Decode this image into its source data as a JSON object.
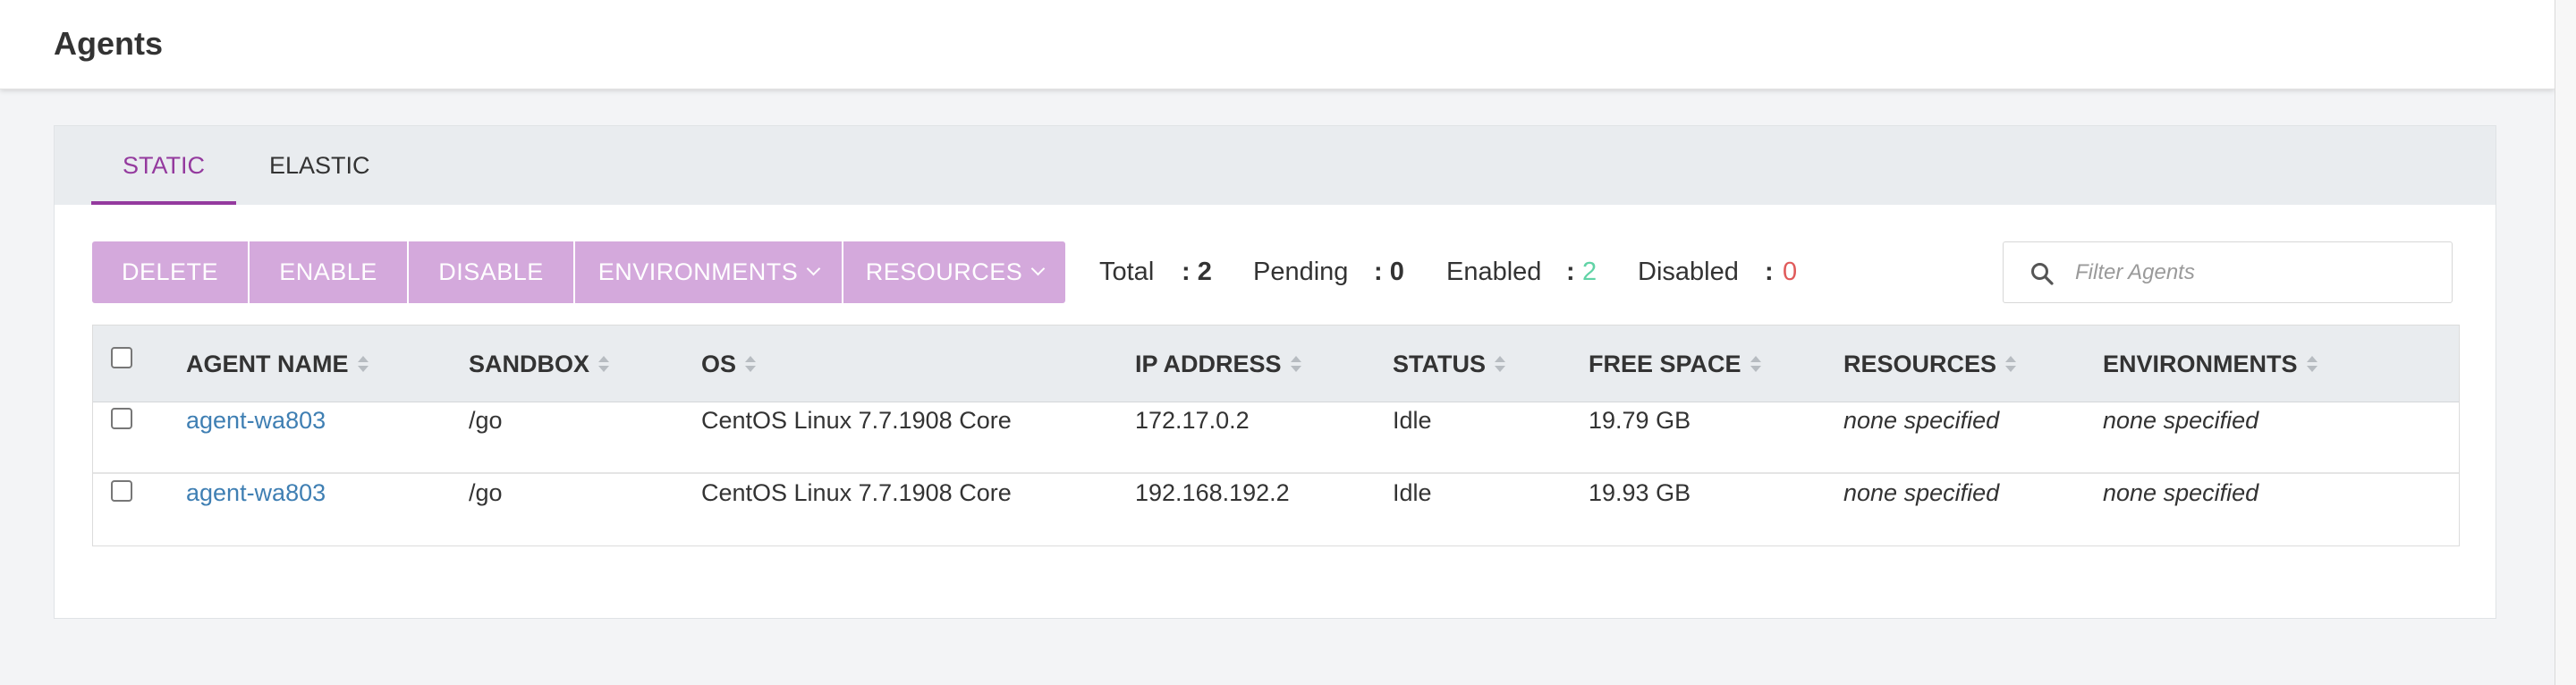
{
  "page": {
    "title": "Agents"
  },
  "tabs": [
    {
      "label": "STATIC",
      "active": true
    },
    {
      "label": "ELASTIC",
      "active": false
    }
  ],
  "toolbar": {
    "delete_label": "DELETE",
    "enable_label": "ENABLE",
    "disable_label": "DISABLE",
    "environments_label": "ENVIRONMENTS",
    "resources_label": "RESOURCES"
  },
  "stats": {
    "total_label": "Total",
    "total_value": ": 2",
    "pending_label": "Pending",
    "pending_value": ": 0",
    "enabled_label": "Enabled",
    "enabled_sep": ":",
    "enabled_value": "2",
    "disabled_label": "Disabled",
    "disabled_sep": ":",
    "disabled_value": "0"
  },
  "search": {
    "placeholder": "Filter Agents"
  },
  "table": {
    "headers": [
      "AGENT NAME",
      "SANDBOX",
      "OS",
      "IP ADDRESS",
      "STATUS",
      "FREE SPACE",
      "RESOURCES",
      "ENVIRONMENTS"
    ],
    "rows": [
      {
        "name": "agent-wa803",
        "sandbox": "/go",
        "os": "CentOS Linux 7.7.1908 Core",
        "ip": "172.17.0.2",
        "status": "Idle",
        "free_space": "19.79 GB",
        "resources": "none specified",
        "environments": "none specified"
      },
      {
        "name": "agent-wa803",
        "sandbox": "/go",
        "os": "CentOS Linux 7.7.1908 Core",
        "ip": "192.168.192.2",
        "status": "Idle",
        "free_space": "19.93 GB",
        "resources": "none specified",
        "environments": "none specified"
      }
    ]
  },
  "colors": {
    "accent": "#943a9e",
    "button": "#d4a9dc",
    "link": "#3f7fb3",
    "enabled": "#61d3a6",
    "disabled": "#e05a5a"
  }
}
